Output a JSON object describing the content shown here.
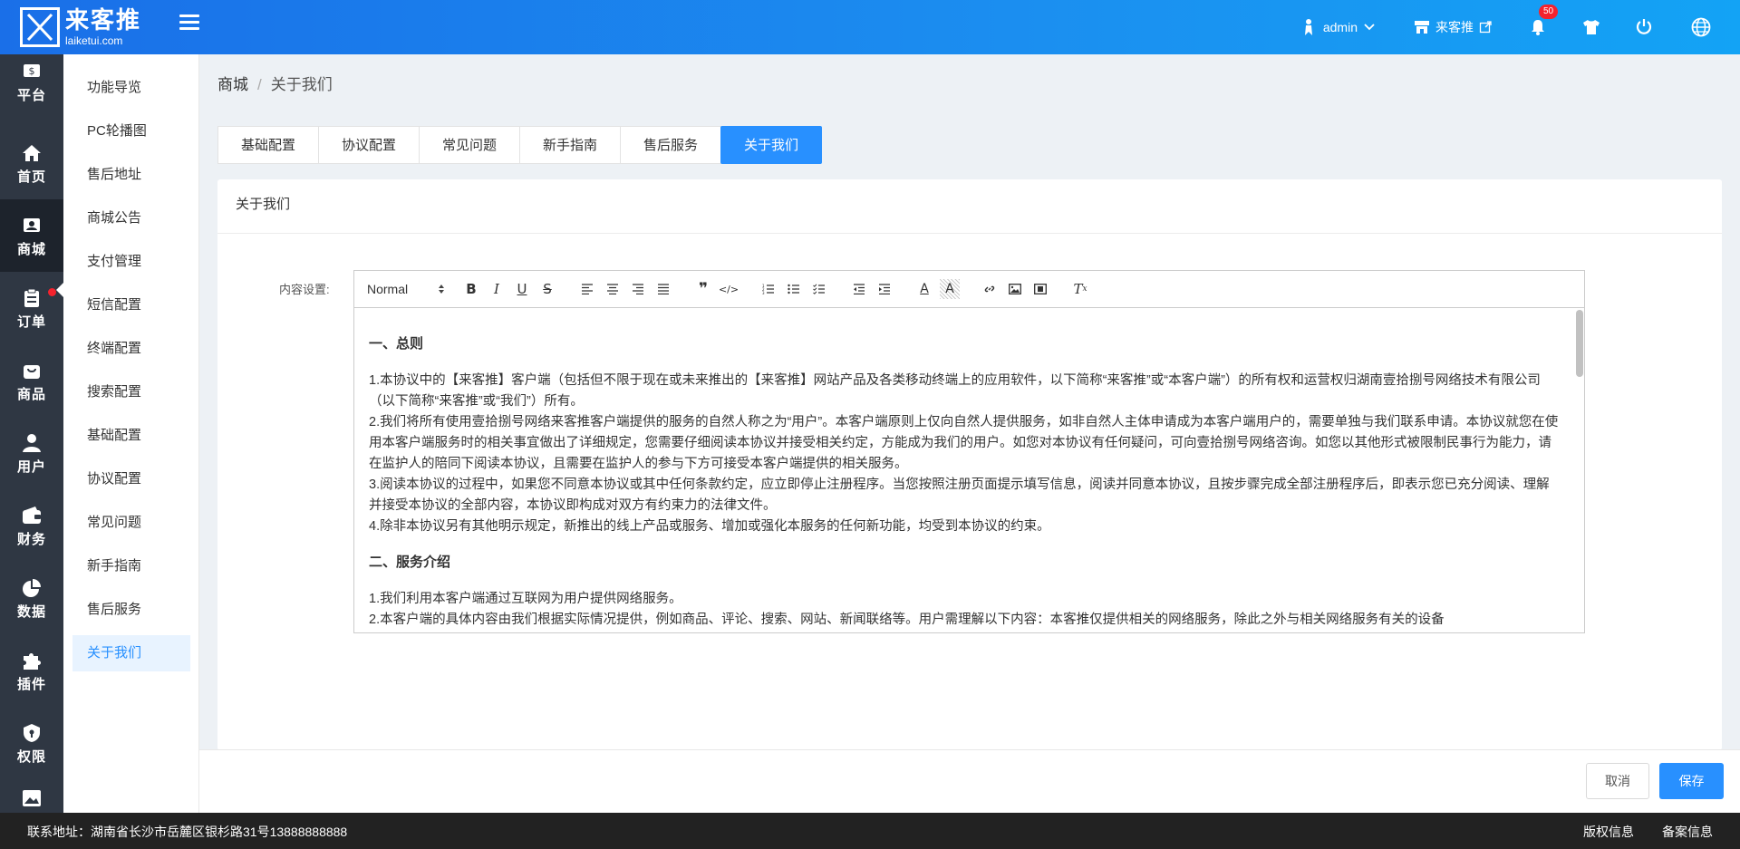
{
  "header": {
    "logo_cn": "来客推",
    "logo_en": "laiketui.com",
    "user": "admin",
    "store": "来客推",
    "notification_count": "50"
  },
  "icon_nav": [
    {
      "label": "平台",
      "icon": "dollar-icon"
    },
    {
      "label": "首页",
      "icon": "home-icon"
    },
    {
      "label": "商城",
      "icon": "store-icon"
    },
    {
      "label": "订单",
      "icon": "clipboard-icon"
    },
    {
      "label": "商品",
      "icon": "bag-icon"
    },
    {
      "label": "用户",
      "icon": "user-icon"
    },
    {
      "label": "财务",
      "icon": "wallet-icon"
    },
    {
      "label": "数据",
      "icon": "pie-chart-icon"
    },
    {
      "label": "插件",
      "icon": "puzzle-icon"
    },
    {
      "label": "权限",
      "icon": "shield-icon"
    },
    {
      "label": "",
      "icon": "image-icon"
    }
  ],
  "sub_menu": [
    "功能导览",
    "PC轮播图",
    "售后地址",
    "商城公告",
    "支付管理",
    "短信配置",
    "终端配置",
    "搜索配置",
    "基础配置",
    "协议配置",
    "常见问题",
    "新手指南",
    "售后服务",
    "关于我们"
  ],
  "breadcrumb": {
    "root": "商城",
    "sep": "/",
    "current": "关于我们"
  },
  "tabs": [
    "基础配置",
    "协议配置",
    "常见问题",
    "新手指南",
    "售后服务",
    "关于我们"
  ],
  "card": {
    "title": "关于我们",
    "field_label": "内容设置:",
    "format_select": "Normal"
  },
  "content": {
    "h1": "一、总则",
    "p1": "1.本协议中的【来客推】客户端（包括但不限于现在或未来推出的【来客推】网站产品及各类移动终端上的应用软件，以下简称“来客推”或“本客户端”）的所有权和运营权归湖南壹拾捌号网络技术有限公司（以下简称“来客推”或“我们”）所有。",
    "p2": "2.我们将所有使用壹拾捌号网络来客推客户端提供的服务的自然人称之为“用户”。本客户端原则上仅向自然人提供服务，如非自然人主体申请成为本客户端用户的，需要单独与我们联系申请。本协议就您在使用本客户端服务时的相关事宜做出了详细规定，您需要仔细阅读本协议并接受相关约定，方能成为我们的用户。如您对本协议有任何疑问，可向壹拾捌号网络咨询。如您以其他形式被限制民事行为能力，请在监护人的陪同下阅读本协议，且需要在监护人的参与下方可接受本客户端提供的相关服务。",
    "p3": "3.阅读本协议的过程中，如果您不同意本协议或其中任何条款约定，应立即停止注册程序。当您按照注册页面提示填写信息，阅读并同意本协议，且按步骤完成全部注册程序后，即表示您已充分阅读、理解并接受本协议的全部内容，本协议即构成对双方有约束力的法律文件。",
    "p4": "4.除非本协议另有其他明示规定，新推出的线上产品或服务、增加或强化本服务的任何新功能，均受到本协议的约束。",
    "h2": "二、服务介绍",
    "p5": "1.我们利用本客户端通过互联网为用户提供网络服务。",
    "p6": "2.本客户端的具体内容由我们根据实际情况提供，例如商品、评论、搜索、网站、新闻联络等。用户需理解以下内容：本客推仅提供相关的网络服务，除此之外与相关网络服务有关的设备"
  },
  "actions": {
    "cancel": "取消",
    "save": "保存"
  },
  "footer": {
    "address": "联系地址：湖南省长沙市岳麓区银杉路31号13888888888",
    "copyright": "版权信息",
    "record": "备案信息"
  },
  "colors": {
    "primary": "#2890ff",
    "nav_bg": "#2f3743",
    "badge": "#f5222d"
  }
}
